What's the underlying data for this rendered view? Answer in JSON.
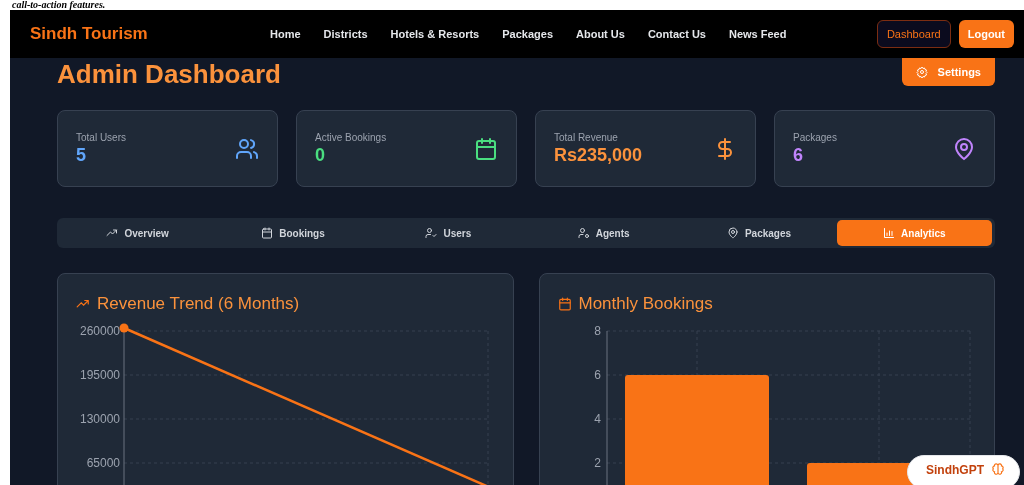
{
  "top_caption": "call-to-action features.",
  "navbar": {
    "brand": "Sindh Tourism",
    "links": [
      "Home",
      "Districts",
      "Hotels & Resorts",
      "Packages",
      "About Us",
      "Contact Us",
      "News Feed"
    ],
    "buttons": [
      {
        "label": "Dashboard",
        "kind": "outline"
      },
      {
        "label": "Logout",
        "kind": "filled"
      }
    ]
  },
  "page_title": "Admin Dashboard",
  "settings_button": "Settings",
  "stats": [
    {
      "label": "Total Users",
      "value": "5",
      "kind": "users",
      "color": "#60a5fa"
    },
    {
      "label": "Active Bookings",
      "value": "0",
      "kind": "calendar",
      "color": "#4ade80"
    },
    {
      "label": "Total Revenue",
      "value": "Rs235,000",
      "kind": "dollar",
      "color": "#fb923c"
    },
    {
      "label": "Packages",
      "value": "6",
      "kind": "pin",
      "color": "#c084fc"
    }
  ],
  "tabs": [
    {
      "label": "Overview",
      "kind": "trend",
      "selected": false
    },
    {
      "label": "Bookings",
      "kind": "calendar",
      "selected": false
    },
    {
      "label": "Users",
      "kind": "user-check",
      "selected": false
    },
    {
      "label": "Agents",
      "kind": "user-gear",
      "selected": false
    },
    {
      "label": "Packages",
      "kind": "pin",
      "selected": false
    },
    {
      "label": "Analytics",
      "kind": "bars",
      "selected": true
    }
  ],
  "revenue_card": {
    "title": "Revenue Trend (6 Months)",
    "y_tick_labels": [
      "260000",
      "195000",
      "130000",
      "65000"
    ]
  },
  "bookings_card": {
    "title": "Monthly Bookings",
    "y_tick_labels": [
      "8",
      "6",
      "4",
      "2"
    ]
  },
  "assistant_button": "SindhGPT"
}
